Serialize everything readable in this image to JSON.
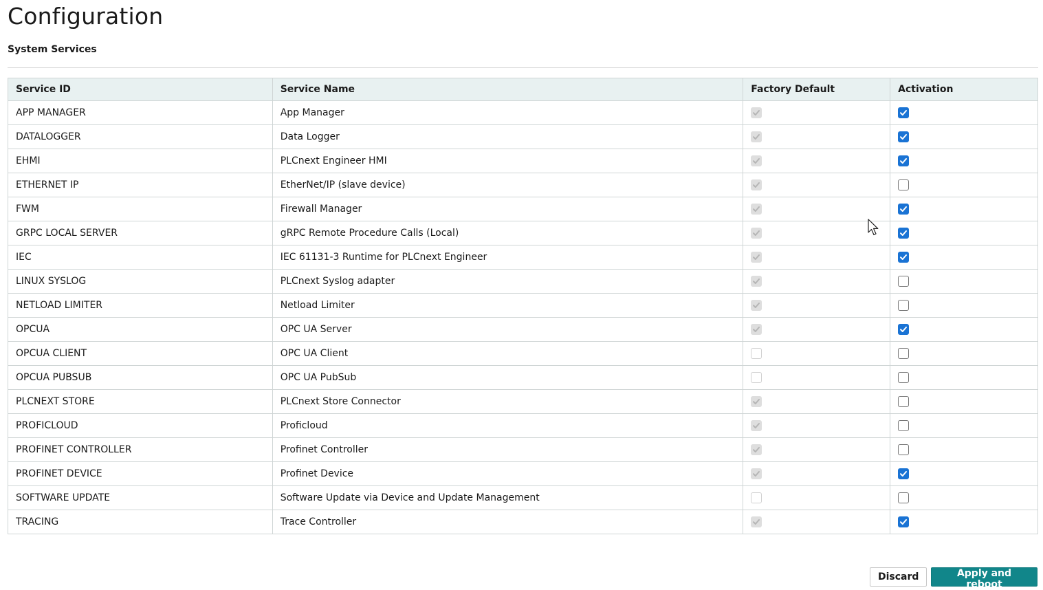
{
  "page": {
    "title": "Configuration",
    "section_title": "System Services"
  },
  "table": {
    "headers": [
      "Service ID",
      "Service Name",
      "Factory Default",
      "Activation"
    ],
    "rows": [
      {
        "id": "APP MANAGER",
        "name": "App Manager",
        "factory_default": true,
        "activation": true
      },
      {
        "id": "DATALOGGER",
        "name": "Data Logger",
        "factory_default": true,
        "activation": true
      },
      {
        "id": "EHMI",
        "name": "PLCnext Engineer HMI",
        "factory_default": true,
        "activation": true
      },
      {
        "id": "ETHERNET IP",
        "name": "EtherNet/IP (slave device)",
        "factory_default": true,
        "activation": false
      },
      {
        "id": "FWM",
        "name": "Firewall Manager",
        "factory_default": true,
        "activation": true
      },
      {
        "id": "GRPC LOCAL SERVER",
        "name": "gRPC Remote Procedure Calls (Local)",
        "factory_default": true,
        "activation": true
      },
      {
        "id": "IEC",
        "name": "IEC 61131-3 Runtime for PLCnext Engineer",
        "factory_default": true,
        "activation": true
      },
      {
        "id": "LINUX SYSLOG",
        "name": "PLCnext Syslog adapter",
        "factory_default": true,
        "activation": false
      },
      {
        "id": "NETLOAD LIMITER",
        "name": "Netload Limiter",
        "factory_default": true,
        "activation": false
      },
      {
        "id": "OPCUA",
        "name": "OPC UA Server",
        "factory_default": true,
        "activation": true
      },
      {
        "id": "OPCUA CLIENT",
        "name": "OPC UA Client",
        "factory_default": false,
        "activation": false
      },
      {
        "id": "OPCUA PUBSUB",
        "name": "OPC UA PubSub",
        "factory_default": false,
        "activation": false
      },
      {
        "id": "PLCNEXT STORE",
        "name": "PLCnext Store Connector",
        "factory_default": true,
        "activation": false
      },
      {
        "id": "PROFICLOUD",
        "name": "Proficloud",
        "factory_default": true,
        "activation": false
      },
      {
        "id": "PROFINET CONTROLLER",
        "name": "Profinet Controller",
        "factory_default": true,
        "activation": false
      },
      {
        "id": "PROFINET DEVICE",
        "name": "Profinet Device",
        "factory_default": true,
        "activation": true
      },
      {
        "id": "SOFTWARE UPDATE",
        "name": "Software Update via Device and Update Management",
        "factory_default": false,
        "activation": false
      },
      {
        "id": "TRACING",
        "name": "Trace Controller",
        "factory_default": true,
        "activation": true
      }
    ]
  },
  "buttons": {
    "discard_label": "Discard",
    "apply_label": "Apply and reboot"
  },
  "colors": {
    "accent_checkbox": "#1a73d4",
    "primary_button": "#11868a",
    "header_background": "#e8f1f1"
  },
  "icons": {
    "checkmark": "checkmark-icon",
    "cursor": "mouse-pointer-icon"
  }
}
